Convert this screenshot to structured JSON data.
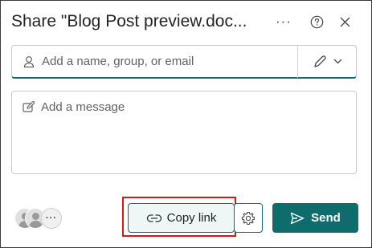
{
  "dialog": {
    "title": "Share \"Blog Post preview.doc...",
    "more_icon": "more-horizontal-icon",
    "help_icon": "question-circle-icon",
    "close_icon": "close-icon"
  },
  "recipients": {
    "placeholder": "Add a name, group, or email",
    "icon": "person-icon",
    "permission_icon": "pencil-edit-icon",
    "chevron_icon": "chevron-down-icon"
  },
  "message": {
    "placeholder": "Add a message",
    "icon": "compose-icon"
  },
  "footer": {
    "avatars_more": "···",
    "copy_link_label": "Copy link",
    "copy_link_icon": "link-icon",
    "settings_icon": "gear-icon",
    "send_label": "Send",
    "send_icon": "send-icon"
  },
  "colors": {
    "accent": "#0f6c6c",
    "highlight": "#d91818"
  }
}
